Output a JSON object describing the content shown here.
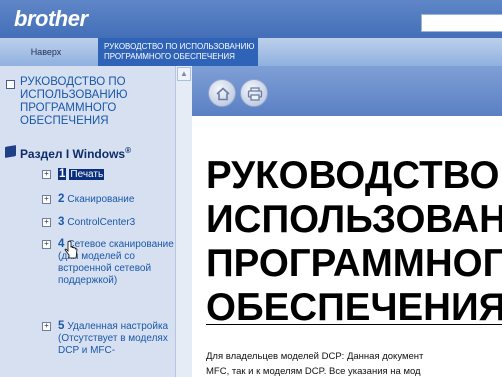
{
  "header": {
    "brand": "brother",
    "nav_up": "Наверх",
    "current_tab": "РУКОВОДСТВО ПО ИСПОЛЬЗОВАНИЮ ПРОГРАММНОГО ОБЕСПЕЧЕНИЯ"
  },
  "sidebar": {
    "root_label": "РУКОВОДСТВО ПО ИСПОЛЬЗОВАНИЮ ПРОГРАММНОГО ОБЕСПЕЧЕНИЯ",
    "section": {
      "label": "Раздел I Windows",
      "sup": "®"
    },
    "items": [
      {
        "num": "1",
        "label": "Печать",
        "selected": true
      },
      {
        "num": "2",
        "label": "Сканирование"
      },
      {
        "num": "3",
        "label": "ControlCenter3"
      },
      {
        "num": "4",
        "label": "Сетевое сканирование (для моделей со встроенной сетевой поддержкой)"
      },
      {
        "num": "5",
        "label": "Удаленная настройка (Отсутствует в моделях DCP и MFC-"
      }
    ]
  },
  "main": {
    "toolbar": {
      "home_icon": "home-icon",
      "print_icon": "printer-icon"
    },
    "title": "РУКОВОДСТВО ПО ИСПОЛЬЗОВАНИЮ ПРОГРАММНОГО ОБЕСПЕЧЕНИЯ",
    "body_line_1": "Для владельцев моделей DCP: Данная документ",
    "body_line_2": "MFC, так и к моделям DCP. Все указания на мод"
  },
  "colors": {
    "header_blue": "#2f5eac",
    "sidebar_bg": "#d6e0f1",
    "link_blue": "#1a58a8",
    "selected_bg": "#0a2f7d"
  }
}
